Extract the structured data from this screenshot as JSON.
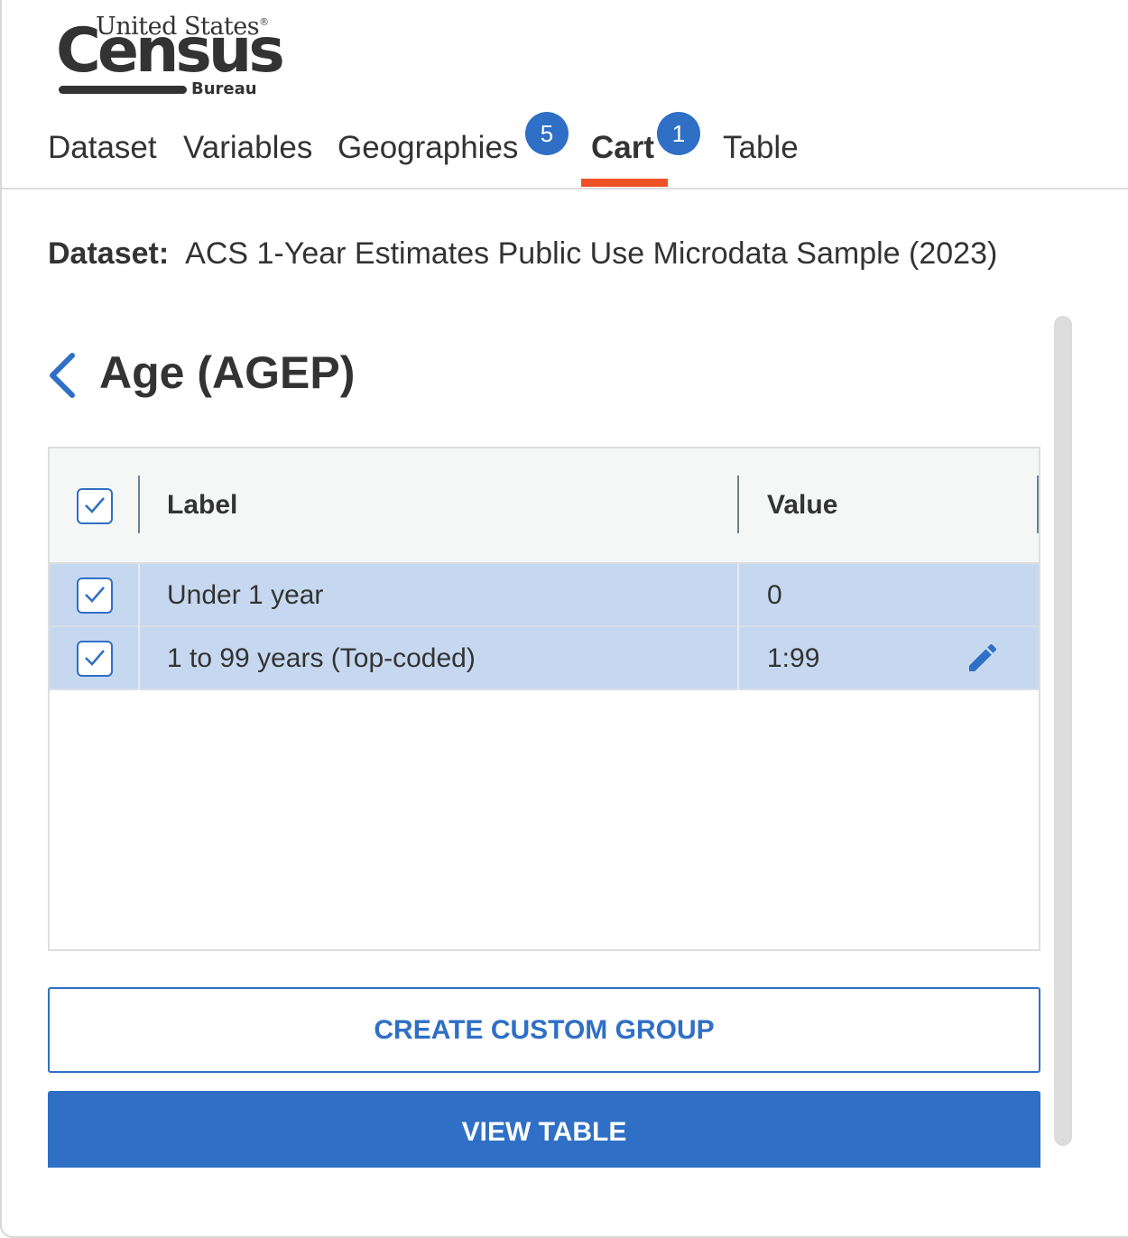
{
  "logo": {
    "line1": "United States",
    "reg": "®",
    "line2": "Census",
    "line3": "Bureau"
  },
  "tabs": [
    {
      "label": "Dataset"
    },
    {
      "label": "Variables"
    },
    {
      "label": "Geographies",
      "badge": "5"
    },
    {
      "label": "Cart",
      "badge": "1",
      "active": true
    },
    {
      "label": "Table"
    }
  ],
  "dataset": {
    "label": "Dataset:",
    "value": "ACS 1-Year Estimates Public Use Microdata Sample (2023)"
  },
  "variable": {
    "title": "Age (AGEP)"
  },
  "grid": {
    "headers": {
      "label": "Label",
      "value": "Value"
    },
    "rows": [
      {
        "label": "Under 1 year",
        "value": "0",
        "checked": true
      },
      {
        "label": "1 to 99 years (Top-coded)",
        "value": "1:99",
        "checked": true
      }
    ]
  },
  "buttons": {
    "custom_group": "CREATE CUSTOM GROUP",
    "view_table": "VIEW TABLE"
  },
  "colors": {
    "accent": "#2f6fc5",
    "tab_underline": "#ef5226",
    "row_selected": "#c6d8ef"
  }
}
